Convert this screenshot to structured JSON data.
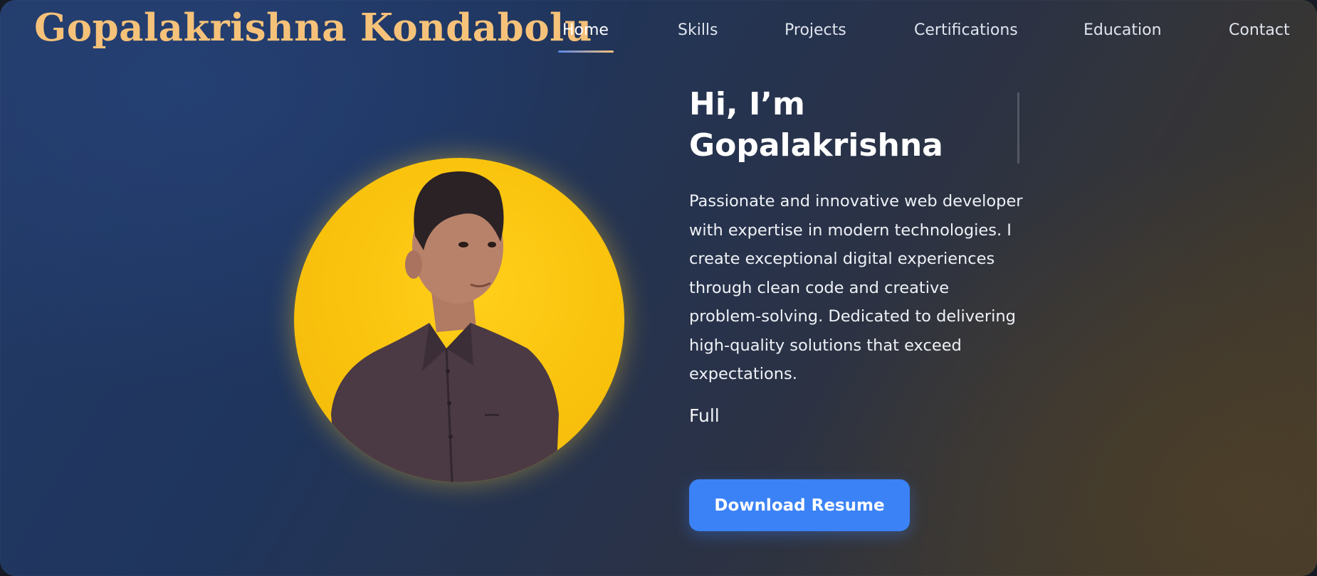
{
  "header": {
    "brand": "Gopalakrishna Kondabolu",
    "nav": [
      {
        "label": "Home",
        "active": true
      },
      {
        "label": "Skills",
        "active": false
      },
      {
        "label": "Projects",
        "active": false
      },
      {
        "label": "Certifications",
        "active": false
      },
      {
        "label": "Education",
        "active": false
      },
      {
        "label": "Contact",
        "active": false
      }
    ]
  },
  "hero": {
    "greeting_line1": "Hi, I’m",
    "greeting_line2": "Gopalakrishna",
    "description": "Passionate and innovative web developer with expertise in modern technologies. I create exceptional digital experiences through clean code and creative problem-solving. Dedicated to delivering high-quality solutions that exceed expectations.",
    "role_typed": "Full",
    "resume_button": "Download Resume",
    "avatar_icon": "profile-photo"
  },
  "colors": {
    "brand": "#f6c27a",
    "accent": "#3b82f6",
    "avatar_bg": "#f9c20c"
  }
}
